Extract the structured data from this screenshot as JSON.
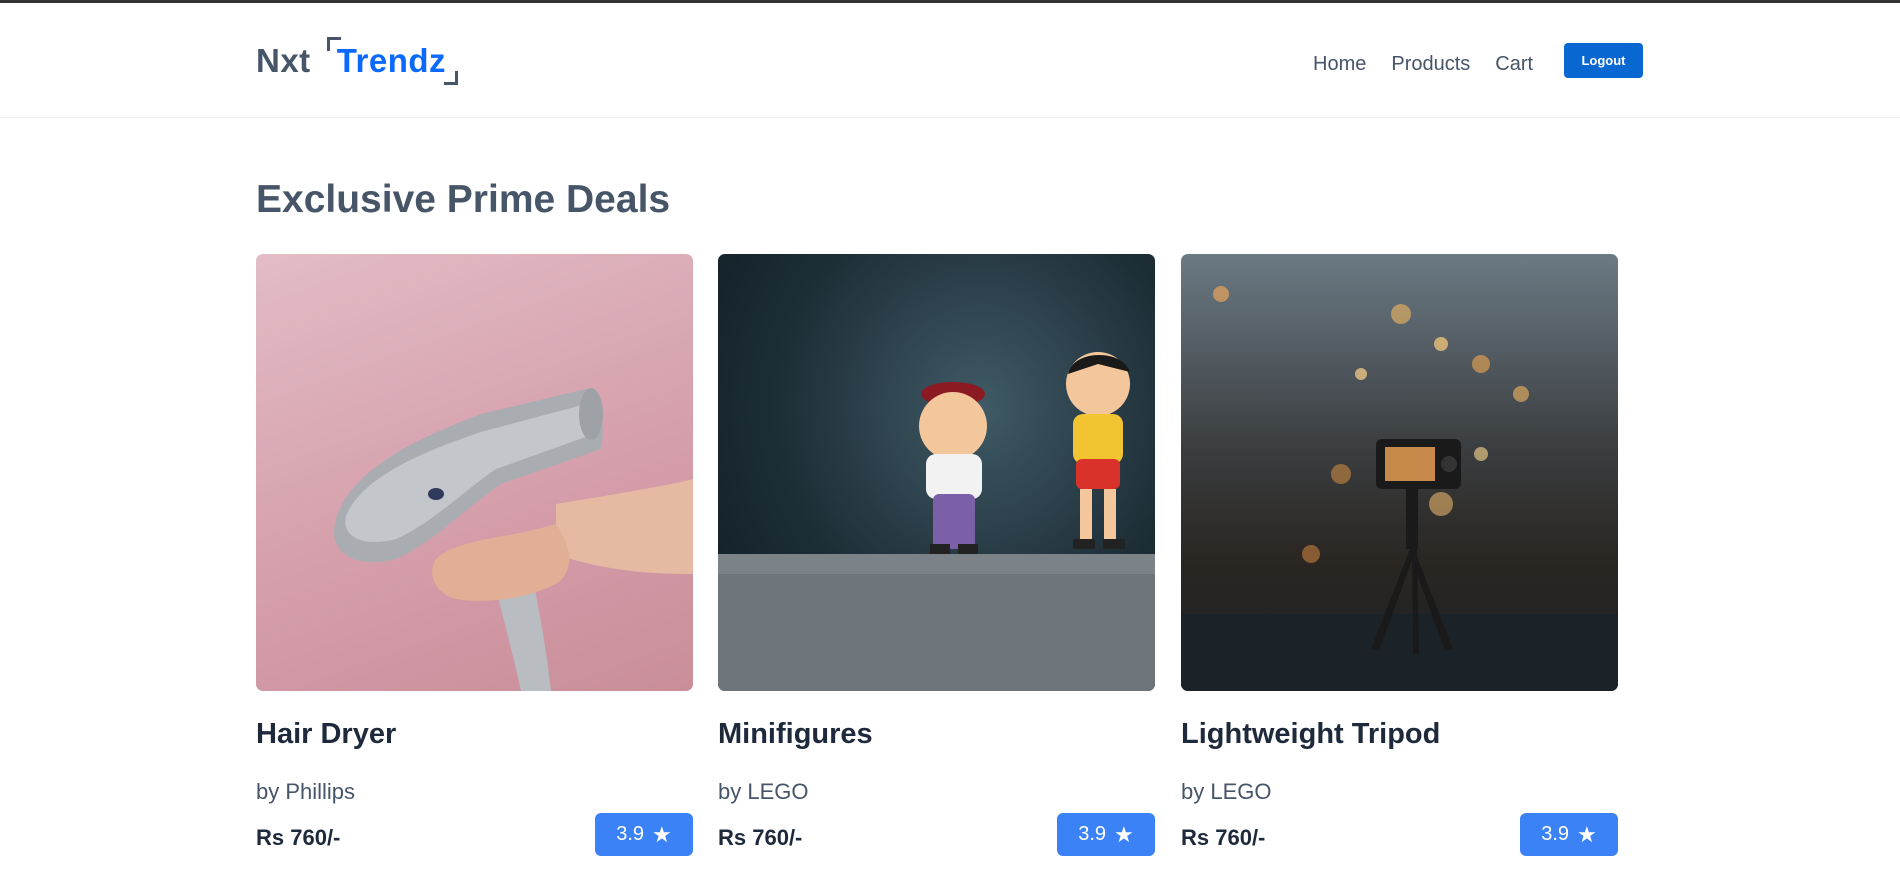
{
  "brand": {
    "left": "Nxt",
    "right": "Trendz"
  },
  "nav": {
    "links": [
      "Home",
      "Products",
      "Cart"
    ],
    "logout_label": "Logout"
  },
  "section": {
    "title": "Exclusive Prime Deals"
  },
  "products": [
    {
      "title": "Hair Dryer",
      "brand": "by Phillips",
      "price": "Rs 760/-",
      "rating": "3.9",
      "image": "hair-dryer-photo"
    },
    {
      "title": "Minifigures",
      "brand": "by LEGO",
      "price": "Rs 760/-",
      "rating": "3.9",
      "image": "minifigures-photo"
    },
    {
      "title": "Lightweight Tripod",
      "brand": "by LEGO",
      "price": "Rs 760/-",
      "rating": "3.9",
      "image": "tripod-photo"
    }
  ],
  "colors": {
    "accent": "#0b69ff",
    "logout_bg": "#0967d2",
    "rating_bg": "#3b82f6",
    "heading": "#475569"
  },
  "icons": {
    "rating": "star-icon"
  }
}
